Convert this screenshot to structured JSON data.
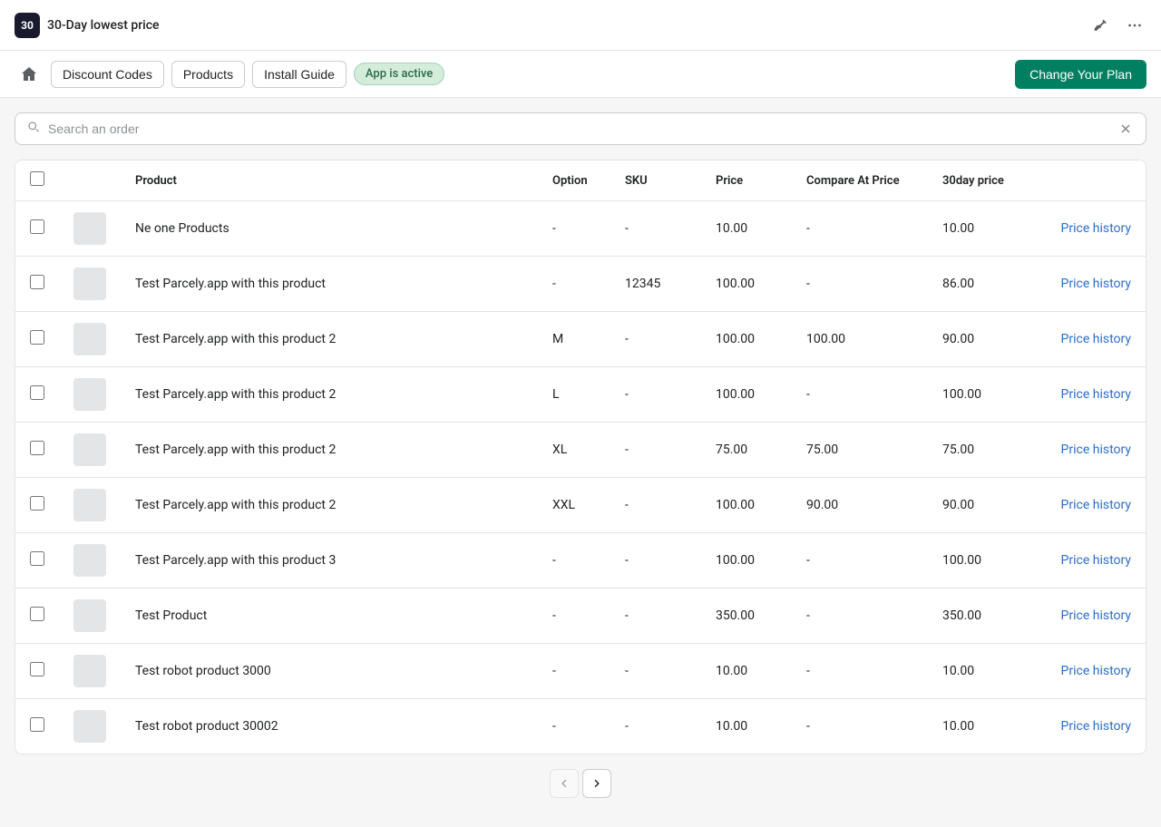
{
  "topbar": {
    "logo_text": "30",
    "app_title": "30-Day lowest price"
  },
  "navbar": {
    "discount_codes_label": "Discount Codes",
    "products_label": "Products",
    "install_guide_label": "Install Guide",
    "app_status_label": "App is active",
    "change_plan_label": "Change Your Plan"
  },
  "search": {
    "placeholder": "Search an order"
  },
  "table": {
    "headers": {
      "product": "Product",
      "option": "Option",
      "sku": "SKU",
      "price": "Price",
      "compare_at_price": "Compare At Price",
      "day30_price": "30day price",
      "action": ""
    },
    "rows": [
      {
        "id": 1,
        "product": "Ne one Products",
        "option": "-",
        "sku": "-",
        "price": "10.00",
        "compare_at_price": "-",
        "day30_price": "10.00",
        "action_label": "Price history"
      },
      {
        "id": 2,
        "product": "Test Parcely.app with this product",
        "option": "-",
        "sku": "12345",
        "price": "100.00",
        "compare_at_price": "-",
        "day30_price": "86.00",
        "action_label": "Price history"
      },
      {
        "id": 3,
        "product": "Test Parcely.app with this product 2",
        "option": "M",
        "sku": "-",
        "price": "100.00",
        "compare_at_price": "100.00",
        "day30_price": "90.00",
        "action_label": "Price history"
      },
      {
        "id": 4,
        "product": "Test Parcely.app with this product 2",
        "option": "L",
        "sku": "-",
        "price": "100.00",
        "compare_at_price": "-",
        "day30_price": "100.00",
        "action_label": "Price history"
      },
      {
        "id": 5,
        "product": "Test Parcely.app with this product 2",
        "option": "XL",
        "sku": "-",
        "price": "75.00",
        "compare_at_price": "75.00",
        "day30_price": "75.00",
        "action_label": "Price history"
      },
      {
        "id": 6,
        "product": "Test Parcely.app with this product 2",
        "option": "XXL",
        "sku": "-",
        "price": "100.00",
        "compare_at_price": "90.00",
        "day30_price": "90.00",
        "action_label": "Price history"
      },
      {
        "id": 7,
        "product": "Test Parcely.app with this product 3",
        "option": "-",
        "sku": "-",
        "price": "100.00",
        "compare_at_price": "-",
        "day30_price": "100.00",
        "action_label": "Price history"
      },
      {
        "id": 8,
        "product": "Test Product",
        "option": "-",
        "sku": "-",
        "price": "350.00",
        "compare_at_price": "-",
        "day30_price": "350.00",
        "action_label": "Price history"
      },
      {
        "id": 9,
        "product": "Test robot product 3000",
        "option": "-",
        "sku": "-",
        "price": "10.00",
        "compare_at_price": "-",
        "day30_price": "10.00",
        "action_label": "Price history"
      },
      {
        "id": 10,
        "product": "Test robot product 30002",
        "option": "-",
        "sku": "-",
        "price": "10.00",
        "compare_at_price": "-",
        "day30_price": "10.00",
        "action_label": "Price history"
      }
    ]
  },
  "pagination": {
    "prev_label": "‹",
    "next_label": "›"
  }
}
